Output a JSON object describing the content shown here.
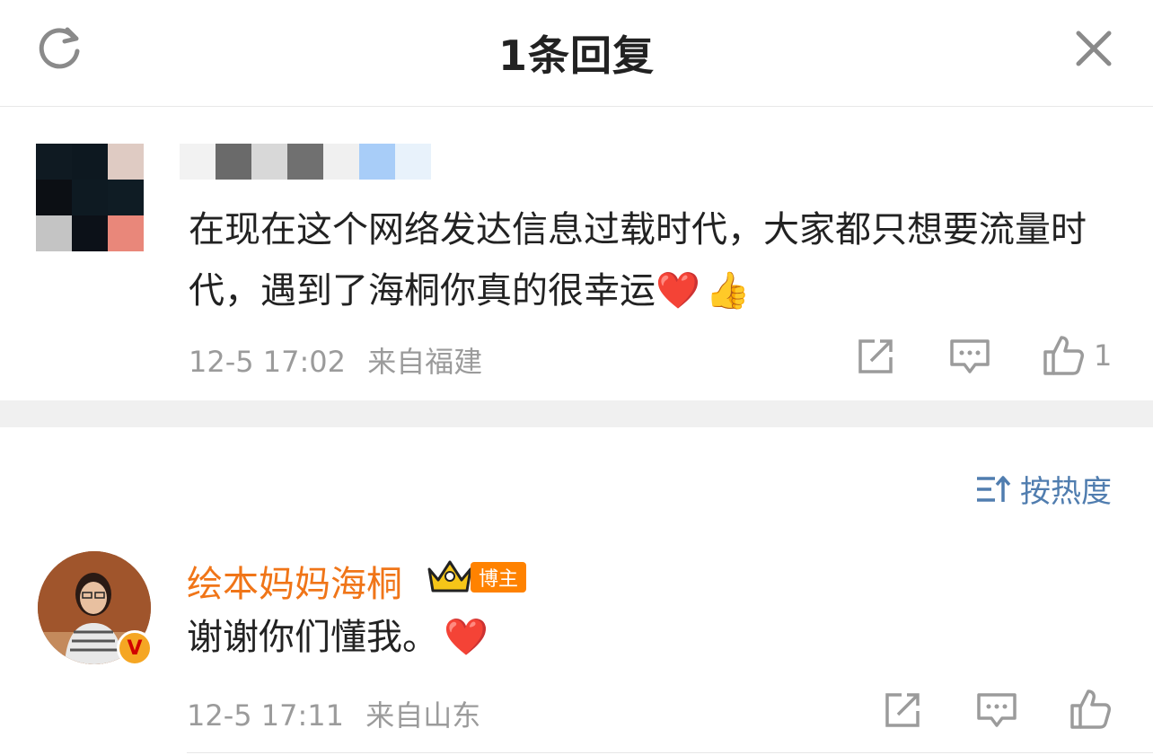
{
  "header": {
    "title": "1条回复",
    "refresh_icon": "refresh-icon",
    "close_icon": "close-icon"
  },
  "comment": {
    "text": "在现在这个网络发达信息过载时代，大家都只想要流量时代，遇到了海桐你真的很幸运",
    "emoji_heart": "❤️",
    "emoji_thumb": "👍",
    "time": "12-5 17:02",
    "location": "来自福建",
    "like_count": "1"
  },
  "sort": {
    "label": "按热度"
  },
  "reply": {
    "author": "绘本妈妈海桐",
    "badge": "博主",
    "text": "谢谢你们懂我。",
    "emoji_heart": "❤️",
    "time": "12-5 17:11",
    "location": "来自山东"
  },
  "colors": {
    "link_blue": "#507daf",
    "author_orange": "#f07518",
    "badge_orange": "#ff8200",
    "meta_gray": "#9b9b9b"
  }
}
